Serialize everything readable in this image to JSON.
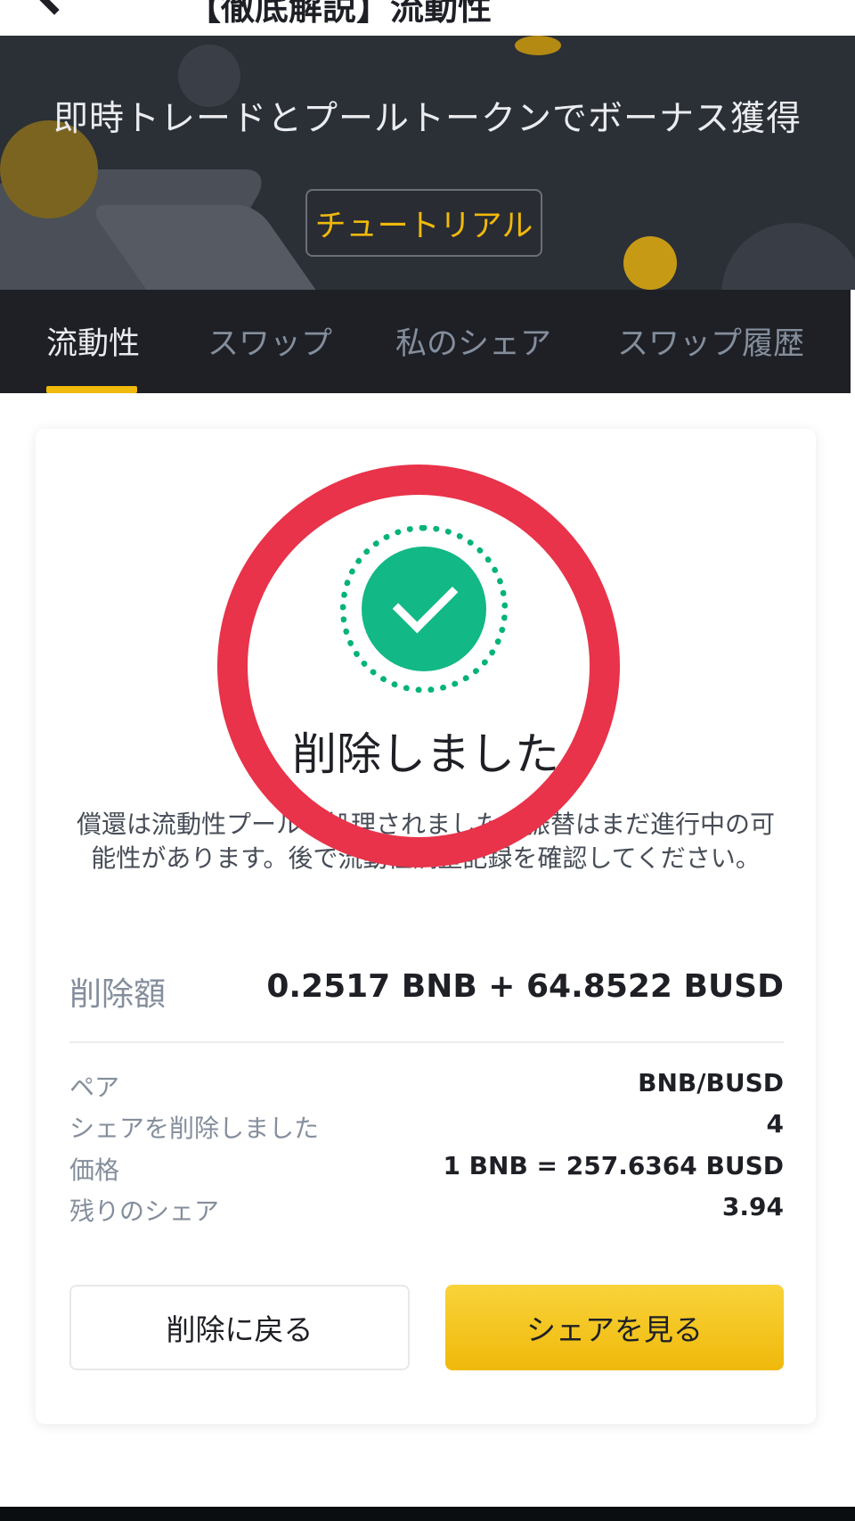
{
  "header": {
    "title": "【徹底解説】流動性"
  },
  "banner": {
    "subtitle": "即時トレードとプールトークンでボーナス獲得",
    "tutorial_label": "チュートリアル"
  },
  "tabs": [
    {
      "label": "流動性",
      "active": true
    },
    {
      "label": "スワップ",
      "active": false
    },
    {
      "label": "私のシェア",
      "active": false
    },
    {
      "label": "スワップ履歴",
      "active": false
    }
  ],
  "result": {
    "title": "削除しました",
    "description": "償還は流動性プールで処理されました。振替はまだ進行中の可能性があります。後で流動性調整記録を確認してください。",
    "amount_label": "削除額",
    "amount_value": "0.2517 BNB + 64.8522 BUSD",
    "details": [
      {
        "label": "ペア",
        "value": "BNB/BUSD"
      },
      {
        "label": "シェアを削除しました",
        "value": "4"
      },
      {
        "label": "価格",
        "value": "1 BNB = 257.6364 BUSD"
      },
      {
        "label": "残りのシェア",
        "value": "3.94"
      }
    ],
    "back_button": "削除に戻る",
    "view_button": "シェアを見る"
  },
  "colors": {
    "accent": "#f0b90b",
    "success": "#12b886",
    "annotation_ring": "#e8334a"
  }
}
